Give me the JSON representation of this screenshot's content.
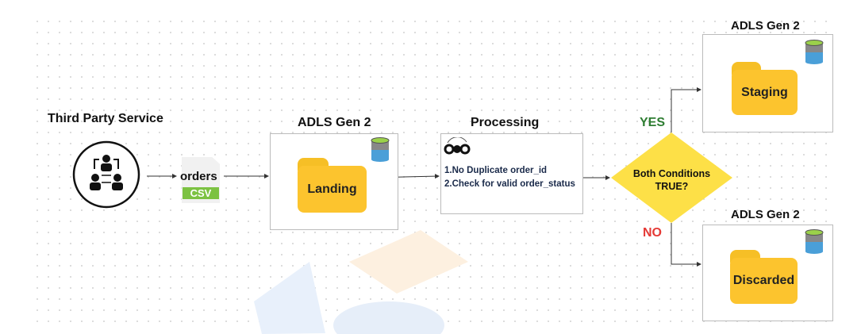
{
  "source": {
    "title": "Third Party Service",
    "icon": "people-network-icon"
  },
  "file": {
    "name": "orders",
    "type": "CSV",
    "color": "#7cc242"
  },
  "landing": {
    "title": "ADLS Gen 2",
    "folder": "Landing"
  },
  "processing": {
    "title": "Processing",
    "rules": [
      "1.No Duplicate order_id",
      "2.Check for valid order_status"
    ]
  },
  "decision": {
    "label_line1": "Both Conditions",
    "label_line2": "TRUE?",
    "yes": "YES",
    "no": "NO",
    "yes_color": "#2e7d32",
    "no_color": "#e53935",
    "fill": "#fde047"
  },
  "staging": {
    "title": "ADLS Gen 2",
    "folder": "Staging"
  },
  "discarded": {
    "title": "ADLS Gen 2",
    "folder": "Discarded"
  }
}
